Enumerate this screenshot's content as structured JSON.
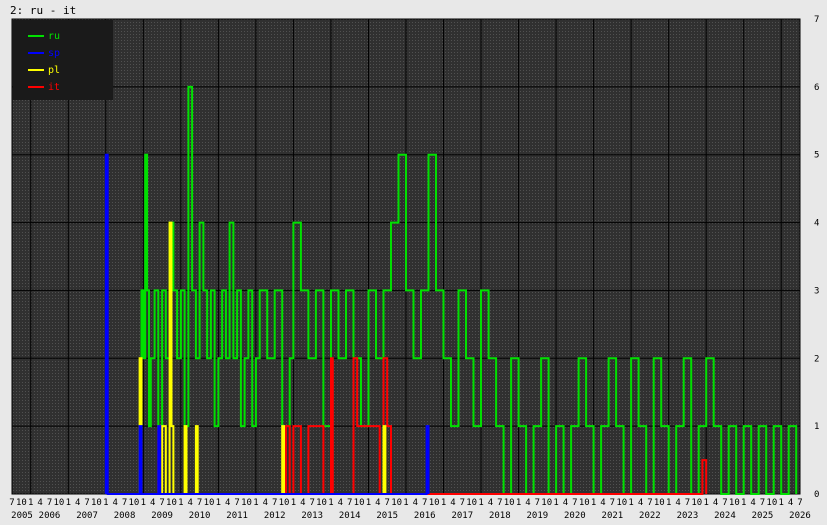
{
  "header": {
    "title": "2: ru - it"
  },
  "chart_data": {
    "type": "line",
    "title": "2: ru - it",
    "xlabel": "",
    "ylabel": "",
    "ylim": [
      0,
      7
    ],
    "yticks": [
      "0",
      "1",
      "2",
      "3",
      "4",
      "5",
      "6",
      "7"
    ],
    "xlim": [
      2005.5,
      2026.5
    ],
    "years": [
      "2005",
      "2006",
      "2007",
      "2008",
      "2009",
      "2010",
      "2011",
      "2012",
      "2013",
      "2014",
      "2015",
      "2016",
      "2017",
      "2018",
      "2019",
      "2020",
      "2021",
      "2022",
      "2023",
      "2024",
      "2025",
      "2026"
    ],
    "month_ticks": [
      "1",
      "4",
      "7",
      "10"
    ],
    "grid": true,
    "legend_position": "top-left",
    "colors": {
      "ru": "#00e000",
      "sp": "#0000ff",
      "pl": "#ffff00",
      "it": "#ff0000",
      "background": "#303030",
      "grid": "#000000"
    },
    "series": [
      {
        "name": "ru",
        "color": "#00e000",
        "points": [
          [
            2008.95,
            3
          ],
          [
            2009.0,
            2
          ],
          [
            2009.05,
            5
          ],
          [
            2009.1,
            3
          ],
          [
            2009.15,
            1
          ],
          [
            2009.2,
            2
          ],
          [
            2009.3,
            3
          ],
          [
            2009.4,
            1
          ],
          [
            2009.5,
            3
          ],
          [
            2009.6,
            2
          ],
          [
            2009.7,
            4
          ],
          [
            2009.8,
            3
          ],
          [
            2009.9,
            2
          ],
          [
            2010.0,
            3
          ],
          [
            2010.1,
            1
          ],
          [
            2010.2,
            6
          ],
          [
            2010.3,
            3
          ],
          [
            2010.4,
            2
          ],
          [
            2010.5,
            4
          ],
          [
            2010.6,
            3
          ],
          [
            2010.7,
            2
          ],
          [
            2010.8,
            3
          ],
          [
            2010.9,
            1
          ],
          [
            2011.0,
            2
          ],
          [
            2011.1,
            3
          ],
          [
            2011.2,
            2
          ],
          [
            2011.3,
            4
          ],
          [
            2011.4,
            2
          ],
          [
            2011.5,
            3
          ],
          [
            2011.6,
            1
          ],
          [
            2011.7,
            2
          ],
          [
            2011.8,
            3
          ],
          [
            2011.9,
            1
          ],
          [
            2012.0,
            2
          ],
          [
            2012.1,
            3
          ],
          [
            2012.3,
            2
          ],
          [
            2012.5,
            3
          ],
          [
            2012.7,
            1
          ],
          [
            2012.9,
            2
          ],
          [
            2013.0,
            4
          ],
          [
            2013.2,
            3
          ],
          [
            2013.4,
            2
          ],
          [
            2013.6,
            3
          ],
          [
            2013.8,
            1
          ],
          [
            2014.0,
            3
          ],
          [
            2014.2,
            2
          ],
          [
            2014.4,
            3
          ],
          [
            2014.6,
            2
          ],
          [
            2014.8,
            1
          ],
          [
            2015.0,
            3
          ],
          [
            2015.2,
            2
          ],
          [
            2015.4,
            3
          ],
          [
            2015.6,
            4
          ],
          [
            2015.8,
            5
          ],
          [
            2016.0,
            3
          ],
          [
            2016.2,
            2
          ],
          [
            2016.4,
            3
          ],
          [
            2016.6,
            5
          ],
          [
            2016.8,
            3
          ],
          [
            2017.0,
            2
          ],
          [
            2017.2,
            1
          ],
          [
            2017.4,
            3
          ],
          [
            2017.6,
            2
          ],
          [
            2017.8,
            1
          ],
          [
            2018.0,
            3
          ],
          [
            2018.2,
            2
          ],
          [
            2018.4,
            1
          ],
          [
            2018.6,
            0
          ],
          [
            2018.8,
            2
          ],
          [
            2019.0,
            1
          ],
          [
            2019.2,
            0
          ],
          [
            2019.4,
            1
          ],
          [
            2019.6,
            2
          ],
          [
            2019.8,
            0
          ],
          [
            2020.0,
            1
          ],
          [
            2020.2,
            0
          ],
          [
            2020.4,
            1
          ],
          [
            2020.6,
            2
          ],
          [
            2020.8,
            1
          ],
          [
            2021.0,
            0
          ],
          [
            2021.2,
            1
          ],
          [
            2021.4,
            2
          ],
          [
            2021.6,
            1
          ],
          [
            2021.8,
            0
          ],
          [
            2022.0,
            2
          ],
          [
            2022.2,
            1
          ],
          [
            2022.4,
            0
          ],
          [
            2022.6,
            2
          ],
          [
            2022.8,
            1
          ],
          [
            2023.0,
            0
          ],
          [
            2023.2,
            1
          ],
          [
            2023.4,
            2
          ],
          [
            2023.6,
            0
          ],
          [
            2023.8,
            1
          ],
          [
            2024.0,
            2
          ],
          [
            2024.2,
            1
          ],
          [
            2024.4,
            0
          ],
          [
            2024.6,
            1
          ],
          [
            2024.8,
            0
          ],
          [
            2025.0,
            1
          ],
          [
            2025.2,
            0
          ],
          [
            2025.4,
            1
          ],
          [
            2025.6,
            0
          ],
          [
            2025.8,
            1
          ],
          [
            2026.0,
            0
          ],
          [
            2026.2,
            1
          ],
          [
            2026.4,
            0
          ]
        ]
      },
      {
        "name": "sp",
        "color": "#0000ff",
        "points": [
          [
            2008.0,
            5
          ],
          [
            2008.05,
            0
          ],
          [
            2008.9,
            1
          ],
          [
            2008.95,
            0
          ],
          [
            2009.4,
            1
          ],
          [
            2009.45,
            0
          ],
          [
            2016.55,
            1
          ],
          [
            2016.6,
            0
          ]
        ]
      },
      {
        "name": "pl",
        "color": "#ffff00",
        "points": [
          [
            2008.9,
            2
          ],
          [
            2008.95,
            0
          ],
          [
            2009.5,
            1
          ],
          [
            2009.6,
            0
          ],
          [
            2009.7,
            4
          ],
          [
            2009.75,
            1
          ],
          [
            2009.8,
            0
          ],
          [
            2010.1,
            1
          ],
          [
            2010.15,
            0
          ],
          [
            2010.4,
            1
          ],
          [
            2010.45,
            0
          ],
          [
            2012.7,
            1
          ],
          [
            2012.75,
            0
          ],
          [
            2015.4,
            1
          ],
          [
            2015.45,
            0
          ]
        ]
      },
      {
        "name": "it",
        "color": "#ff0000",
        "points": [
          [
            2009.4,
            1
          ],
          [
            2009.45,
            0
          ],
          [
            2012.8,
            1
          ],
          [
            2012.9,
            0
          ],
          [
            2013.0,
            1
          ],
          [
            2013.2,
            0
          ],
          [
            2013.4,
            1
          ],
          [
            2013.6,
            1
          ],
          [
            2013.8,
            0
          ],
          [
            2014.0,
            2
          ],
          [
            2014.05,
            0
          ],
          [
            2014.6,
            2
          ],
          [
            2014.7,
            1
          ],
          [
            2015.0,
            1
          ],
          [
            2015.3,
            0
          ],
          [
            2015.4,
            2
          ],
          [
            2015.5,
            1
          ],
          [
            2015.6,
            0
          ],
          [
            2023.9,
            0.5
          ],
          [
            2024.0,
            0
          ]
        ]
      }
    ]
  }
}
